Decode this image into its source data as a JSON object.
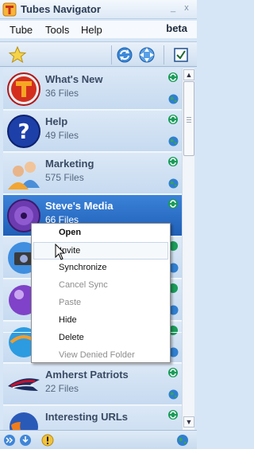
{
  "window": {
    "title": "Tubes Navigator",
    "minimize_glyph": "_",
    "close_glyph": "x"
  },
  "menubar": {
    "items": [
      "Tube",
      "Tools",
      "Help"
    ],
    "beta_label": "beta"
  },
  "toolbar": {
    "icons": [
      "favorites-star-icon",
      "refresh-icon",
      "network-sync-icon",
      "checkbox-icon"
    ]
  },
  "tubes": [
    {
      "name": "What's New",
      "count": "36 Files",
      "icon": "tubes-logo-icon"
    },
    {
      "name": "Help",
      "count": "49 Files",
      "icon": "help-question-icon"
    },
    {
      "name": "Marketing",
      "count": "575 Files",
      "icon": "people-icon"
    },
    {
      "name": "Steve's Media",
      "count": "66 Files",
      "icon": "media-disc-icon"
    },
    {
      "name": "",
      "count": "",
      "icon": "camera-icon"
    },
    {
      "name": "",
      "count": "",
      "icon": "purple-orb-icon"
    },
    {
      "name": "",
      "count": "",
      "icon": "ball-icon"
    },
    {
      "name": "",
      "count": "",
      "icon": ""
    },
    {
      "name": "Amherst Patriots",
      "count": "22 Files",
      "icon": "patriots-logo-icon"
    },
    {
      "name": "Interesting URLs",
      "count": "",
      "icon": "firefox-icon"
    }
  ],
  "context_menu": {
    "items": [
      {
        "label": "Open",
        "bold": true,
        "disabled": false
      },
      {
        "label": "Invite",
        "bold": false,
        "disabled": false
      },
      {
        "label": "Synchronize",
        "bold": false,
        "disabled": false
      },
      {
        "label": "Cancel Sync",
        "bold": false,
        "disabled": true
      },
      {
        "label": "Paste",
        "bold": false,
        "disabled": true
      },
      {
        "label": "Hide",
        "bold": false,
        "disabled": false
      },
      {
        "label": "Delete",
        "bold": false,
        "disabled": false
      },
      {
        "label": "View Denied Folder",
        "bold": false,
        "disabled": true
      }
    ]
  },
  "colors": {
    "selected_row": "#2a6fc9",
    "row": "#cfe0f3",
    "sync_green": "#1a9c5a"
  }
}
